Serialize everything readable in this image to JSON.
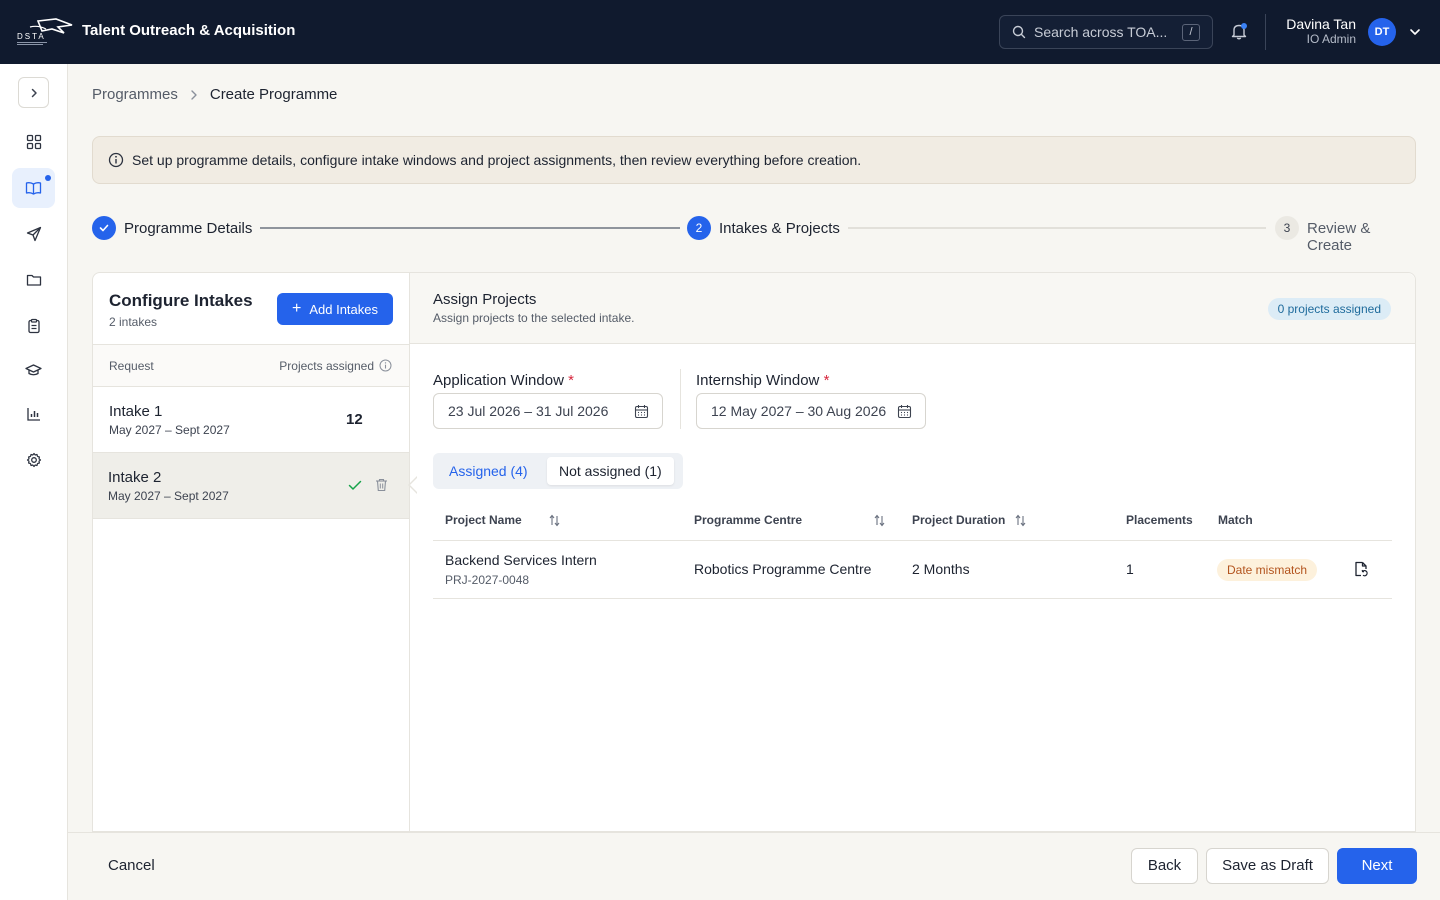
{
  "header": {
    "app_title": "Talent Outreach & Acquisition",
    "search_placeholder": "Search across TOA...",
    "search_shortcut": "/",
    "user_name": "Davina Tan",
    "user_role": "IO Admin",
    "user_initials": "DT"
  },
  "sidebar": {
    "items": [
      {
        "icon": "dashboard-icon"
      },
      {
        "icon": "book-open-icon",
        "active": true
      },
      {
        "icon": "send-icon"
      },
      {
        "icon": "folder-icon"
      },
      {
        "icon": "clipboard-icon"
      },
      {
        "icon": "graduation-cap-icon"
      },
      {
        "icon": "bar-chart-icon"
      },
      {
        "icon": "settings-gear-icon"
      }
    ]
  },
  "breadcrumb": {
    "parent": "Programmes",
    "current": "Create Programme"
  },
  "banner": {
    "text": "Set up programme details, configure intake windows and project assignments, then review everything before creation."
  },
  "stepper": {
    "steps": [
      {
        "number": "1",
        "label": "Programme Details",
        "state": "complete"
      },
      {
        "number": "2",
        "label": "Intakes & Projects",
        "state": "current"
      },
      {
        "number": "3",
        "label": "Review & Create",
        "state": "upcoming"
      }
    ]
  },
  "intakes_panel": {
    "title": "Configure Intakes",
    "count_text": "2 intakes",
    "add_button": "Add Intakes",
    "col_request": "Request",
    "col_projects": "Projects assigned",
    "intakes": [
      {
        "name": "Intake 1",
        "dates": "May 2027 – Sept 2027",
        "projects": "12"
      },
      {
        "name": "Intake 2",
        "dates": "May 2027 – Sept 2027",
        "selected": true
      }
    ]
  },
  "assign_panel": {
    "title": "Assign Projects",
    "subtitle": "Assign projects to the selected intake.",
    "badge": "0 projects assigned",
    "application_window_label": "Application Window",
    "application_window_value": "23 Jul 2026 – 31 Jul 2026",
    "internship_window_label": "Internship Window",
    "internship_window_value": "12 May 2027 – 30 Aug 2026",
    "required_mark": "*",
    "tab_assigned": "Assigned (4)",
    "tab_not_assigned": "Not assigned (1)",
    "columns": {
      "project_name": "Project Name",
      "programme_centre": "Programme Centre",
      "project_duration": "Project Duration",
      "placements": "Placements",
      "match": "Match"
    },
    "rows": [
      {
        "project_name": "Backend Services Intern",
        "project_code": "PRJ-2027-0048",
        "programme_centre": "Robotics Programme Centre",
        "project_duration": "2 Months",
        "placements": "1",
        "match": "Date mismatch"
      }
    ]
  },
  "footer": {
    "cancel": "Cancel",
    "back": "Back",
    "save_draft": "Save as Draft",
    "next": "Next"
  },
  "colors": {
    "topbar": "#101a2e",
    "primary": "#2563eb",
    "warning_text": "#b3541e",
    "warning_bg": "#fdf1dc",
    "success": "#16a34a"
  }
}
